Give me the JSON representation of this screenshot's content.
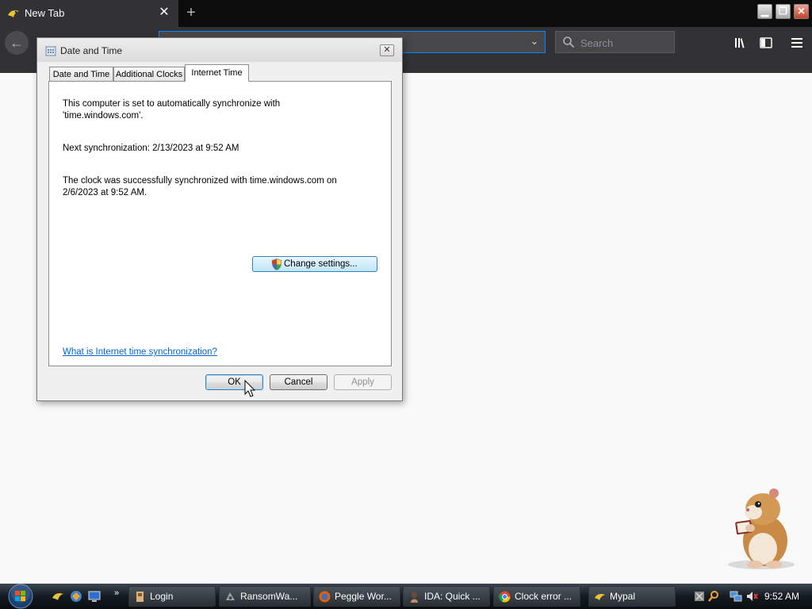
{
  "browser": {
    "tab_title": "New Tab",
    "tab_close": "✕",
    "new_tab": "+",
    "search_placeholder": "Search",
    "back_glyph": "←",
    "url_dropdown_glyph": "⌄"
  },
  "dialog": {
    "title": "Date and Time",
    "close_glyph": "✕",
    "tabs": [
      {
        "label": "Date and Time"
      },
      {
        "label": "Additional Clocks"
      },
      {
        "label": "Internet Time"
      }
    ],
    "active_tab": "Internet Time",
    "lines": {
      "sync_line1": "This computer is set to automatically synchronize with",
      "sync_line2": "'time.windows.com'.",
      "next_sync": "Next synchronization: 2/13/2023 at 9:52 AM",
      "last_line1": "The clock was successfully synchronized with time.windows.com on",
      "last_line2": "2/6/2023 at 9:52 AM."
    },
    "change_settings_label": "Change settings...",
    "help_link": "What is Internet time synchronization?",
    "buttons": {
      "ok": "OK",
      "cancel": "Cancel",
      "apply": "Apply"
    }
  },
  "taskbar": {
    "more_glyph": "»",
    "items": [
      {
        "label": "Login",
        "icon": "login-app-icon"
      },
      {
        "label": "RansomWa...",
        "icon": "ransomware-app-icon"
      },
      {
        "label": "Peggle Wor...",
        "icon": "firefox-icon"
      },
      {
        "label": "IDA: Quick ...",
        "icon": "ida-icon"
      },
      {
        "label": "Clock error ...",
        "icon": "chrome-icon"
      },
      {
        "label": "Mypal",
        "icon": "mypal-icon"
      }
    ],
    "clock": "9:52 AM"
  },
  "colors": {
    "browser_chrome": "#323234",
    "tab_strip": "#0c0c0d",
    "accent": "#0a84ff",
    "link": "#0066cc"
  }
}
